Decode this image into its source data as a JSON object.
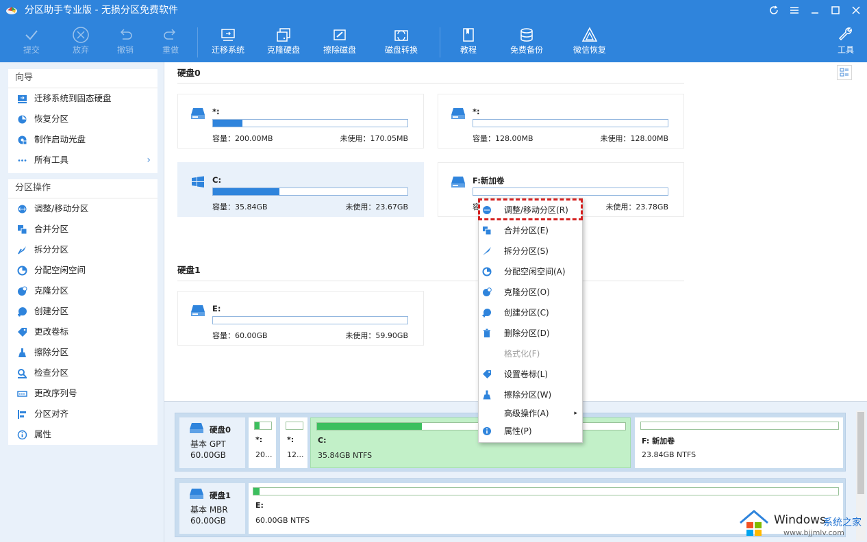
{
  "window": {
    "title": "分区助手专业版 - 无损分区免费软件"
  },
  "toolbar": {
    "commit": "提交",
    "discard": "放弃",
    "undo": "撤销",
    "redo": "重做",
    "migrate": "迁移系统",
    "clone": "克隆硬盘",
    "wipe": "擦除磁盘",
    "convert": "磁盘转换",
    "tutorial": "教程",
    "backup": "免费备份",
    "wechat": "微信恢复",
    "tools": "工具"
  },
  "sidebar": {
    "wizard_title": "向导",
    "wizard_items": [
      {
        "label": "迁移系统到固态硬盘",
        "icon": "migrate-ssd-icon"
      },
      {
        "label": "恢复分区",
        "icon": "recover-partition-icon"
      },
      {
        "label": "制作启动光盘",
        "icon": "bootable-media-icon"
      },
      {
        "label": "所有工具",
        "icon": "more-icon"
      }
    ],
    "ops_title": "分区操作",
    "ops_items": [
      {
        "label": "调整/移动分区",
        "icon": "resize-icon"
      },
      {
        "label": "合并分区",
        "icon": "merge-icon"
      },
      {
        "label": "拆分分区",
        "icon": "split-icon"
      },
      {
        "label": "分配空闲空间",
        "icon": "allocate-icon"
      },
      {
        "label": "克隆分区",
        "icon": "clone-icon"
      },
      {
        "label": "创建分区",
        "icon": "create-icon"
      },
      {
        "label": "更改卷标",
        "icon": "tag-icon"
      },
      {
        "label": "擦除分区",
        "icon": "wipe-icon"
      },
      {
        "label": "检查分区",
        "icon": "check-icon"
      },
      {
        "label": "更改序列号",
        "icon": "serial-icon"
      },
      {
        "label": "分区对齐",
        "icon": "align-icon"
      },
      {
        "label": "属性",
        "icon": "info-icon"
      }
    ]
  },
  "main": {
    "disk0_label": "硬盘0",
    "disk1_label": "硬盘1",
    "partitions": [
      {
        "name": "*:",
        "used": 0.15,
        "capacity": "容量：200.00MB",
        "free": "未使用：170.05MB"
      },
      {
        "name": "*:",
        "used": 0.0,
        "capacity": "容量：128.00MB",
        "free": "未使用：128.00MB"
      },
      {
        "name": "C:",
        "used": 0.34,
        "capacity": "容量：35.84GB",
        "free": "未使用：23.67GB"
      },
      {
        "name": "F:新加卷",
        "used": 0.0,
        "capacity": "容",
        "free": "未使用：23.78GB"
      },
      {
        "name": "E:",
        "used": 0.0,
        "capacity": "容量：60.00GB",
        "free": "未使用：59.90GB"
      }
    ]
  },
  "diskmap": {
    "disk0": {
      "name": "硬盘0",
      "type": "基本 GPT",
      "size": "60.00GB",
      "segments": [
        {
          "name": "*:",
          "info": "20...",
          "used": 0.3
        },
        {
          "name": "*:",
          "info": "12...",
          "used": 0.0
        },
        {
          "name": "C:",
          "info": "35.84GB NTFS",
          "used": 0.34
        },
        {
          "name": "F: 新加卷",
          "info": "23.84GB NTFS",
          "used": 0.0
        }
      ]
    },
    "disk1": {
      "name": "硬盘1",
      "type": "基本 MBR",
      "size": "60.00GB",
      "segments": [
        {
          "name": "E:",
          "info": "60.00GB NTFS",
          "used": 0.01
        }
      ]
    }
  },
  "context_menu": [
    {
      "label": "调整/移动分区(R)",
      "icon": "resize-icon",
      "enabled": true
    },
    {
      "label": "合并分区(E)",
      "icon": "merge-icon",
      "enabled": true
    },
    {
      "label": "拆分分区(S)",
      "icon": "split-icon",
      "enabled": true
    },
    {
      "label": "分配空闲空间(A)",
      "icon": "allocate-icon",
      "enabled": true
    },
    {
      "label": "克隆分区(O)",
      "icon": "clone-icon",
      "enabled": true
    },
    {
      "label": "创建分区(C)",
      "icon": "create-icon",
      "enabled": true
    },
    {
      "label": "删除分区(D)",
      "icon": "delete-icon",
      "enabled": true
    },
    {
      "label": "格式化(F)",
      "icon": "",
      "enabled": false
    },
    {
      "label": "设置卷标(L)",
      "icon": "tag-icon",
      "enabled": true
    },
    {
      "label": "擦除分区(W)",
      "icon": "wipe-icon",
      "enabled": true
    },
    {
      "label": "高级操作(A)",
      "icon": "",
      "enabled": true,
      "submenu": "▸"
    },
    {
      "label": "属性(P)",
      "icon": "info-icon",
      "enabled": true
    }
  ],
  "watermark": {
    "title": "Windows",
    "subtitle": "系统之家",
    "url": "www.bjjmlv.com"
  },
  "colors": {
    "accent": "#2f84dc",
    "used_bar": "#3cbf5e",
    "highlight": "#d42020"
  }
}
